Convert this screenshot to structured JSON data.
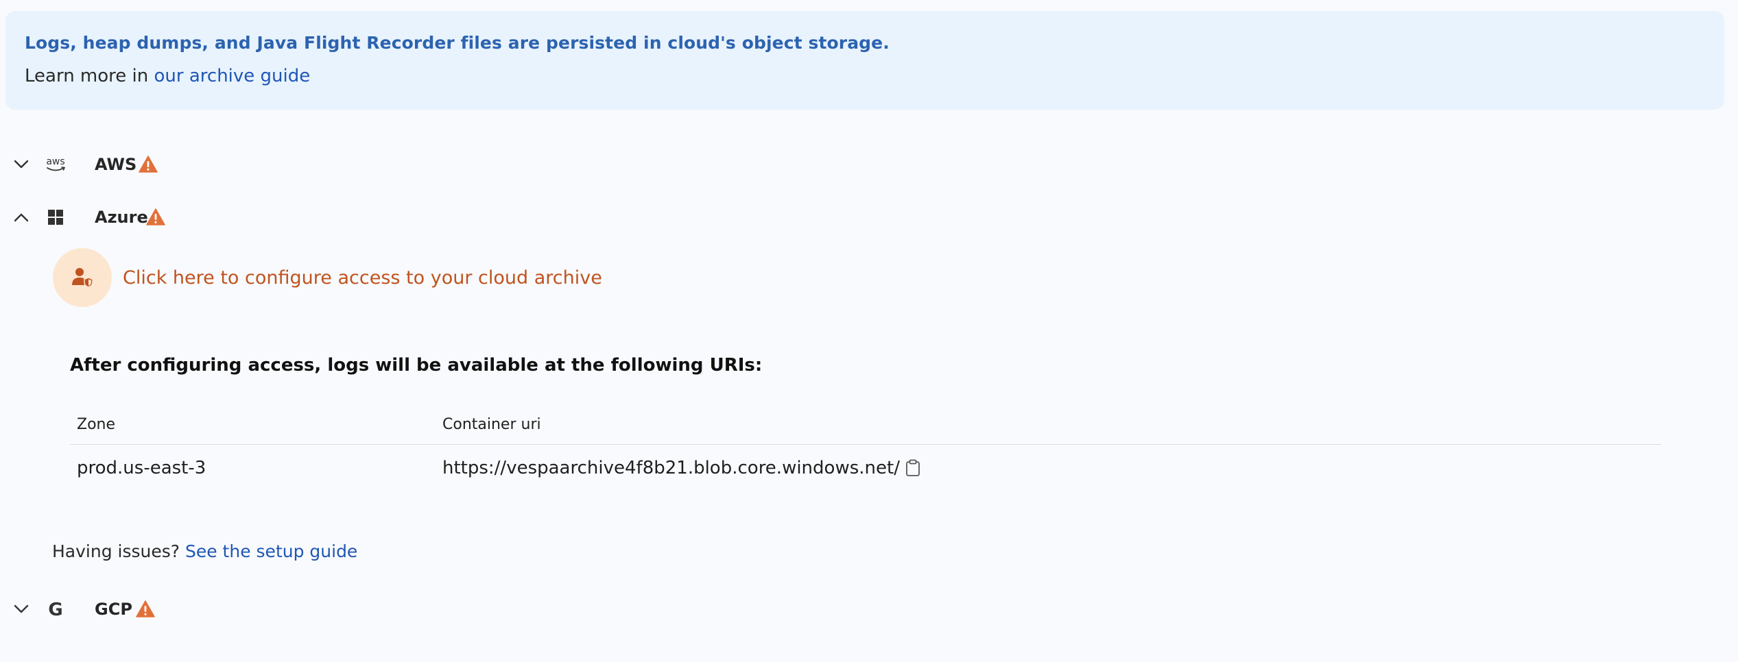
{
  "banner": {
    "title": "Logs, heap dumps, and Java Flight Recorder files are persisted in cloud's object storage.",
    "learn_prefix": "Learn more in ",
    "learn_link": "our archive guide"
  },
  "providers": [
    {
      "name": "AWS",
      "icon": "aws-logo-icon",
      "icon_text": "aws",
      "expanded": false,
      "warning": true
    },
    {
      "name": "Azure",
      "icon": "windows-logo-icon",
      "expanded": true,
      "warning": true
    },
    {
      "name": "GCP",
      "icon": "google-logo-icon",
      "icon_text": "G",
      "expanded": false,
      "warning": true
    }
  ],
  "azure": {
    "config_link": "Click here to configure access to your cloud archive",
    "uris_title": "After configuring access, logs will be available at the following URIs:",
    "table": {
      "headers": [
        "Zone",
        "Container uri"
      ],
      "rows": [
        {
          "zone": "prod.us-east-3",
          "uri": "https://vespaarchive4f8b21.blob.core.windows.net/"
        }
      ]
    },
    "issues_prefix": "Having issues? ",
    "issues_link": "See the setup guide"
  },
  "colors": {
    "banner_bg": "#e8f3fd",
    "banner_title": "#2c63b0",
    "link": "#1f56b5",
    "warning": "#e2703a",
    "config_link": "#c0531f",
    "config_circle": "#fde6cf"
  }
}
